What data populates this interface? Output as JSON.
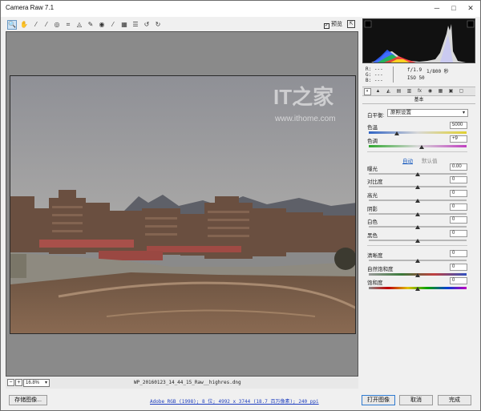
{
  "window": {
    "title": "Camera Raw 7.1",
    "minimize_glyph": "─",
    "maximize_glyph": "□",
    "close_glyph": "✕"
  },
  "toolbar": {
    "tools": [
      {
        "name": "zoom-tool",
        "glyph": "🔍",
        "active": true
      },
      {
        "name": "hand-tool",
        "glyph": "✋"
      },
      {
        "name": "white-balance-tool",
        "glyph": "⁄"
      },
      {
        "name": "color-sampler-tool",
        "glyph": "⁄"
      },
      {
        "name": "targeted-adjust-tool",
        "glyph": "◎"
      },
      {
        "name": "crop-tool",
        "glyph": "⌗"
      },
      {
        "name": "straighten-tool",
        "glyph": "◬"
      },
      {
        "name": "spot-removal-tool",
        "glyph": "✎"
      },
      {
        "name": "red-eye-tool",
        "glyph": "◉"
      },
      {
        "name": "adjustment-brush-tool",
        "glyph": "⁄"
      },
      {
        "name": "graduated-filter-tool",
        "glyph": "▦"
      },
      {
        "name": "preferences-icon",
        "glyph": "☰"
      },
      {
        "name": "rotate-left-icon",
        "glyph": "↺"
      },
      {
        "name": "rotate-right-icon",
        "glyph": "↻"
      }
    ],
    "preview_label": "预览",
    "preview_checked": "✓",
    "fullscreen_glyph": "⇱"
  },
  "canvas": {
    "watermark_main": "IT之家",
    "watermark_url": "www.ithome.com",
    "zoom_minus": "−",
    "zoom_plus": "+",
    "zoom_value": "16.8%",
    "zoom_arrow": "▾",
    "filename": "WP_20160123_14_44_15_Raw__highres.dng"
  },
  "histogram": {
    "r_label": "R:",
    "g_label": "G:",
    "b_label": "B:",
    "r_value": "---",
    "g_value": "---",
    "b_value": "---",
    "aperture": "f/1.9",
    "shutter": "1/800 秒",
    "iso": "ISO 50"
  },
  "panel": {
    "tabs": [
      "◐",
      "▲",
      "◭",
      "▤",
      "▥",
      "fx",
      "◉",
      "▦",
      "▣",
      "▢"
    ],
    "title": "基本",
    "white_balance_label": "白平衡:",
    "white_balance_value": "原照设置",
    "white_balance_arrow": "▾",
    "temperature_label": "色温",
    "temperature_value": "5000",
    "tint_label": "色调",
    "tint_value": "+9",
    "auto_label": "自动",
    "default_label": "默认值",
    "exposure_label": "曝光",
    "exposure_value": "0.00",
    "contrast_label": "对比度",
    "contrast_value": "0",
    "highlights_label": "高光",
    "highlights_value": "0",
    "shadows_label": "阴影",
    "shadows_value": "0",
    "whites_label": "白色",
    "whites_value": "0",
    "blacks_label": "黑色",
    "blacks_value": "0",
    "clarity_label": "清晰度",
    "clarity_value": "0",
    "vibrance_label": "自然饱和度",
    "vibrance_value": "0",
    "saturation_label": "饱和度",
    "saturation_value": "0"
  },
  "bottom": {
    "save_label": "存储图像...",
    "workflow_text": "Adobe RGB (1998); 8 位; 4992 x 3744 (18.7 百万像素); 240 ppi",
    "open_label": "打开图像",
    "cancel_label": "取消",
    "done_label": "完成"
  },
  "colors": {
    "accent": "#2f7bd0",
    "link": "#1f5fbf",
    "canvas_bg": "#8a8a8a"
  }
}
